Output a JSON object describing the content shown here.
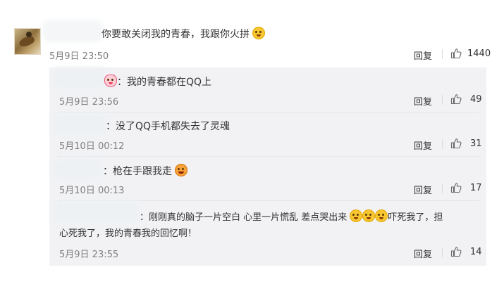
{
  "comment": {
    "text": "你要敢关闭我的青春，我跟你火拼",
    "emoji": "frustrated-emoji",
    "date": "5月9日 23:50",
    "reply_label": "回复",
    "likes": "1440"
  },
  "replies": [
    {
      "prefix": "：",
      "text": "我的青春都在QQ上",
      "emoji": "heart-emoji",
      "date": "5月9日 23:56",
      "reply_label": "回复",
      "likes": "49"
    },
    {
      "prefix": "：",
      "text": "没了QQ手机都失去了灵魂",
      "date": "5月10日 00:12",
      "reply_label": "回复",
      "likes": "31"
    },
    {
      "prefix": "：",
      "text": "枪在手跟我走",
      "emoji": "angry-emoji",
      "date": "5月10日 00:13",
      "reply_label": "回复",
      "likes": "17"
    },
    {
      "prefix": "：",
      "text_line1": "刚刚真的脑子一片空白 心里一片慌乱 差点哭出来",
      "text_line1b": "吓死我了，担",
      "text_line2": "心死我了，我的青春我的回忆啊！",
      "date": "5月9日 23:55",
      "reply_label": "回复",
      "likes": "14"
    }
  ],
  "colors": {
    "reply_bg": "#f2f2f5",
    "date": "#808080",
    "text": "#333333"
  }
}
